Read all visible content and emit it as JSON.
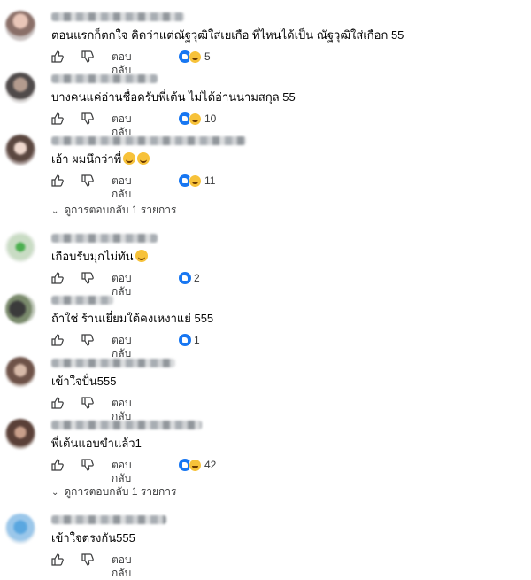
{
  "comments": [
    {
      "text": "ตอนแรกก็ตกใจ คิดว่าแต่ณัฐวุฒิใส่เยเกือ ที่ไหนได้เป็น ณัฐวุฒิใส่เกือก 55",
      "emoji": false,
      "reply_label": "ตอบกลับ",
      "reactions": [
        "like",
        "haha"
      ],
      "count": "5"
    },
    {
      "text": "บางคนแค่อ่านชื่อครับพี่เต้น ไม่ได้อ่านนามสกุล 55",
      "emoji": false,
      "reply_label": "ตอบกลับ",
      "reactions": [
        "like",
        "haha"
      ],
      "count": "10"
    },
    {
      "text": "เอ้า ผมนึกว่าพี่",
      "emoji": true,
      "emoji_count": 2,
      "reply_label": "ตอบกลับ",
      "reactions": [
        "like",
        "haha"
      ],
      "count": "11"
    },
    {
      "text": "เกือบรับมุกไม่ทัน",
      "emoji": true,
      "emoji_count": 1,
      "reply_label": "ตอบกลับ",
      "reactions": [
        "like"
      ],
      "count": "2"
    },
    {
      "text": "ถ้าใช่ ร้านเยี่ยมใต้คงเหงาแย่ 555",
      "emoji": false,
      "reply_label": "ตอบกลับ",
      "reactions": [
        "like"
      ],
      "count": "1"
    },
    {
      "text": "เข้าใจปั่น555",
      "emoji": false,
      "reply_label": "ตอบกลับ",
      "reactions": [],
      "count": ""
    },
    {
      "text": "พี่เต้นแอบขำแล้ว1",
      "emoji": false,
      "reply_label": "ตอบกลับ",
      "reactions": [
        "like",
        "haha"
      ],
      "count": "42"
    },
    {
      "text": "เข้าใจตรงกัน555",
      "emoji": false,
      "reply_label": "ตอบกลับ",
      "reactions": [],
      "count": ""
    }
  ],
  "view_replies": [
    {
      "label": "ดูการตอบกลับ 1 รายการ"
    },
    {
      "label": "ดูการตอบกลับ 1 รายการ"
    }
  ],
  "icons": {
    "like": "thumbs-up-icon",
    "dislike": "thumbs-down-icon",
    "chevron": "chevron-down-icon"
  },
  "colors": {
    "like_blue": "#1877f2",
    "haha_yellow": "#f7c23a",
    "text": "#050505",
    "muted": "#3a3b3c"
  }
}
